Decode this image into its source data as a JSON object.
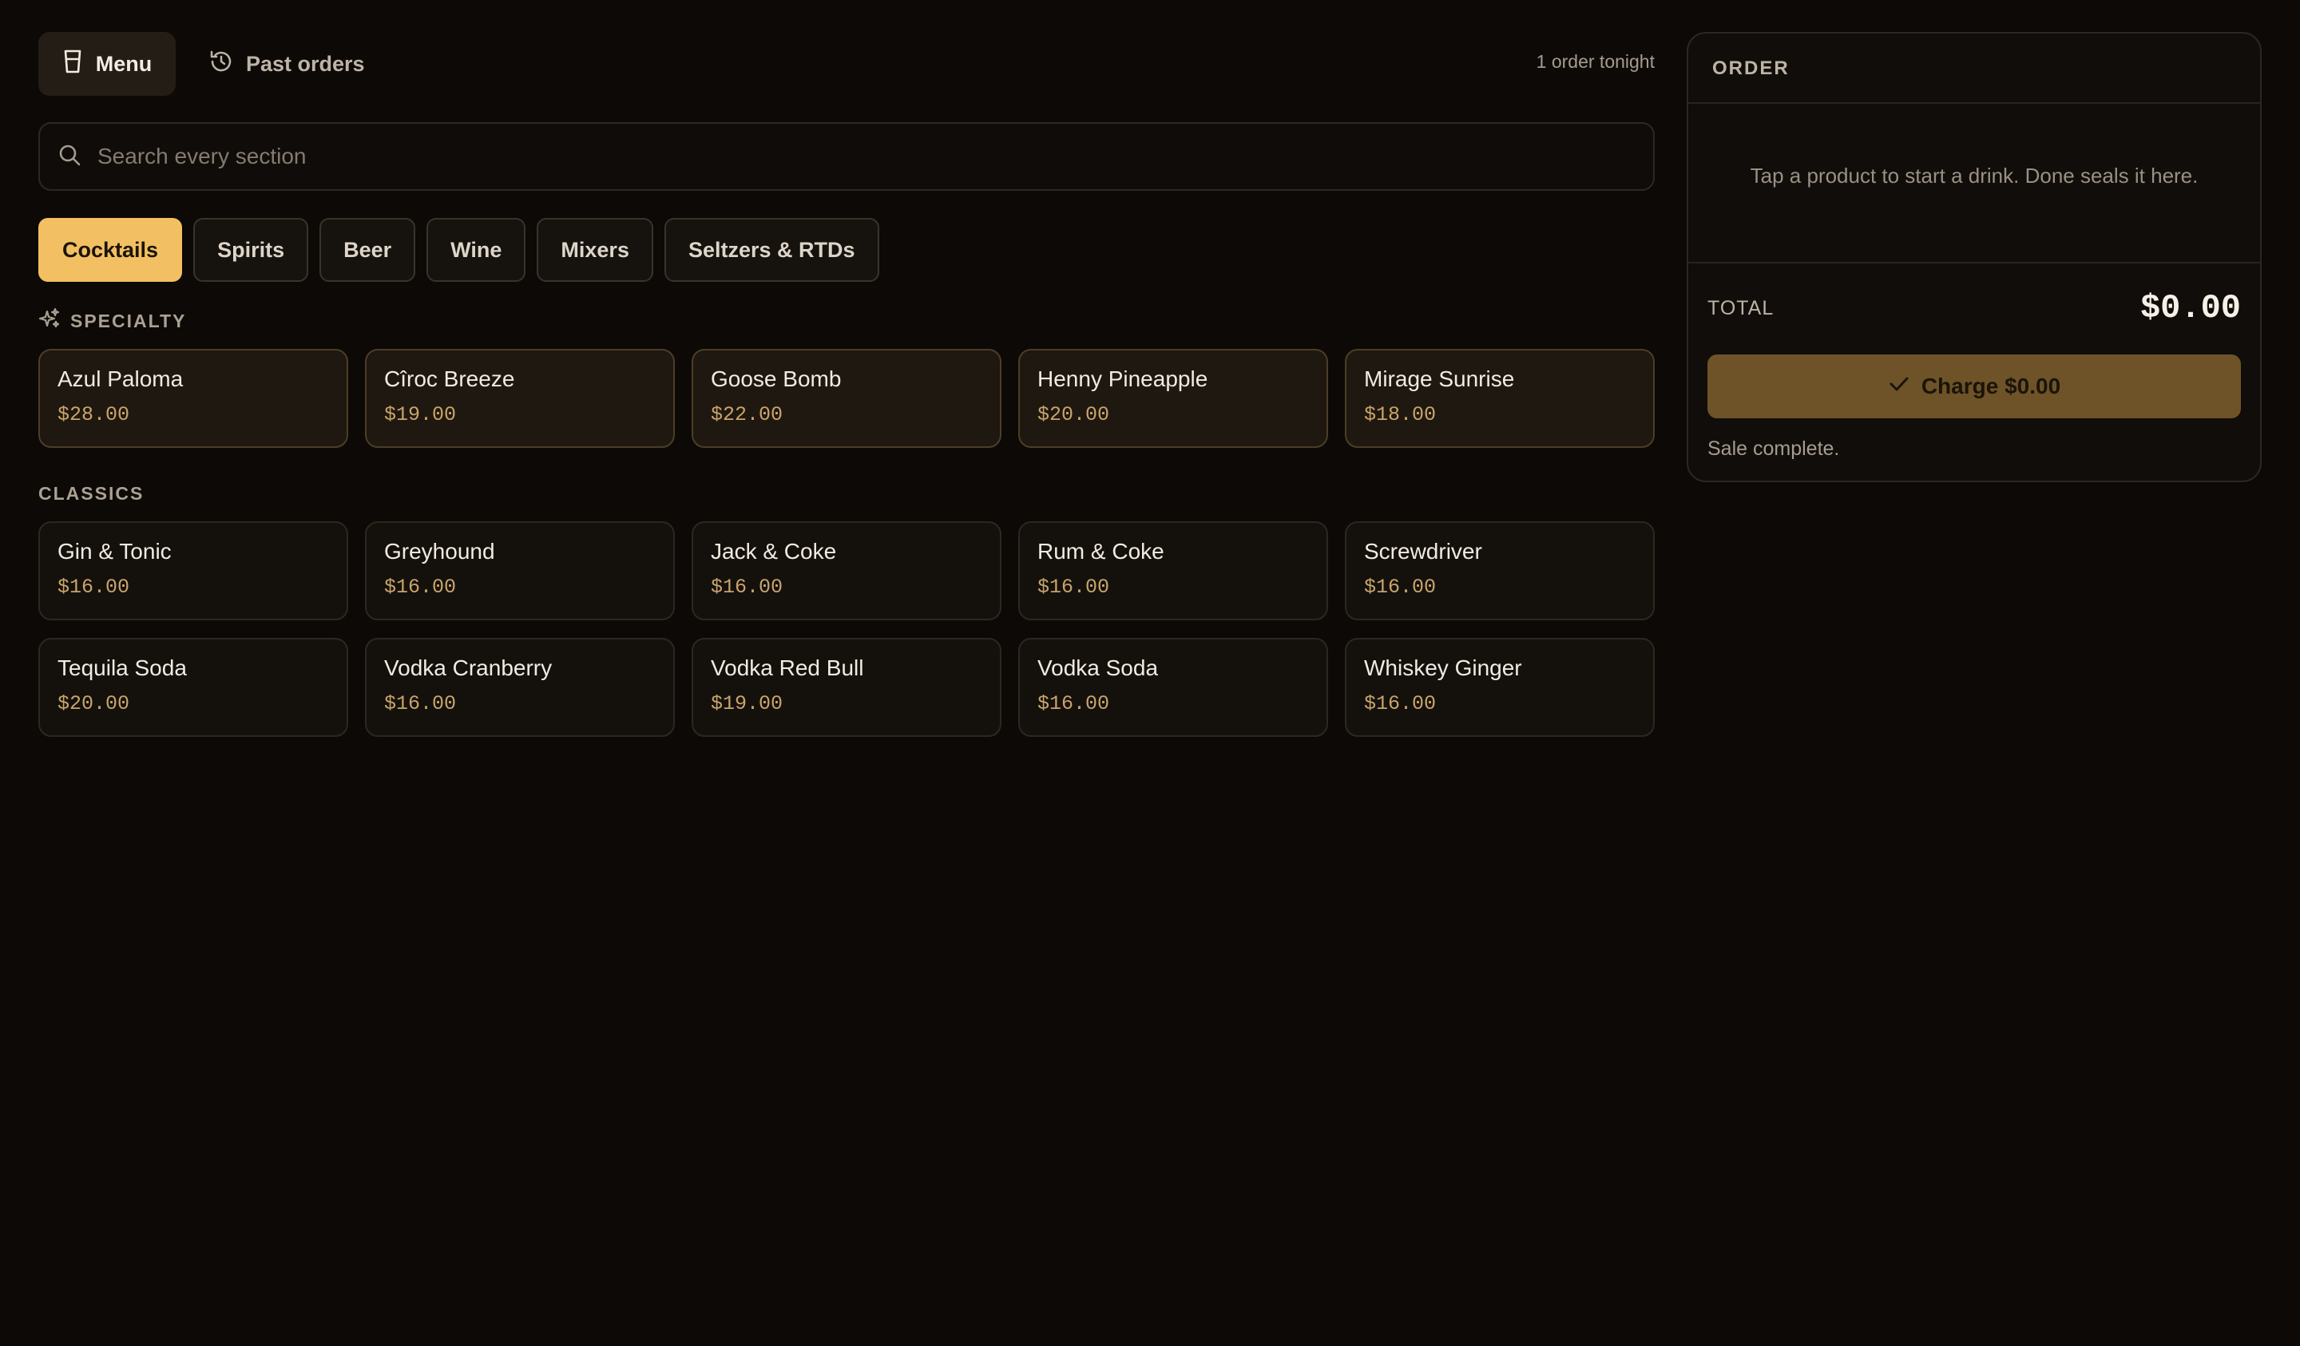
{
  "nav": {
    "menu": {
      "label": "Menu",
      "icon": "glass-icon"
    },
    "past_orders": {
      "label": "Past orders",
      "icon": "history-icon"
    },
    "orders_tonight": "1 order tonight"
  },
  "search": {
    "placeholder": "Search every section",
    "value": ""
  },
  "tabs": [
    "Cocktails",
    "Spirits",
    "Beer",
    "Wine",
    "Mixers",
    "Seltzers & RTDs"
  ],
  "active_tab": "Cocktails",
  "sections": {
    "specialty": {
      "label": "SPECIALTY",
      "icon": "sparkles-icon",
      "items": [
        {
          "name": "Azul Paloma",
          "price": "$28.00"
        },
        {
          "name": "Cîroc Breeze",
          "price": "$19.00"
        },
        {
          "name": "Goose Bomb",
          "price": "$22.00"
        },
        {
          "name": "Henny Pineapple",
          "price": "$20.00"
        },
        {
          "name": "Mirage Sunrise",
          "price": "$18.00"
        }
      ]
    },
    "classics": {
      "label": "CLASSICS",
      "items": [
        {
          "name": "Gin & Tonic",
          "price": "$16.00"
        },
        {
          "name": "Greyhound",
          "price": "$16.00"
        },
        {
          "name": "Jack & Coke",
          "price": "$16.00"
        },
        {
          "name": "Rum & Coke",
          "price": "$16.00"
        },
        {
          "name": "Screwdriver",
          "price": "$16.00"
        },
        {
          "name": "Tequila Soda",
          "price": "$20.00"
        },
        {
          "name": "Vodka Cranberry",
          "price": "$16.00"
        },
        {
          "name": "Vodka Red Bull",
          "price": "$19.00"
        },
        {
          "name": "Vodka Soda",
          "price": "$16.00"
        },
        {
          "name": "Whiskey Ginger",
          "price": "$16.00"
        }
      ]
    }
  },
  "order": {
    "title": "ORDER",
    "empty_message": "Tap a product to start a drink. Done seals it here.",
    "total_label": "TOTAL",
    "total_value": "$0.00",
    "charge_label": "Charge $0.00",
    "status": "Sale complete."
  },
  "colors": {
    "background": "#0c0906",
    "accent": "#f2c063",
    "charge_button": "#6e5328",
    "price_text": "#c9a46a"
  }
}
